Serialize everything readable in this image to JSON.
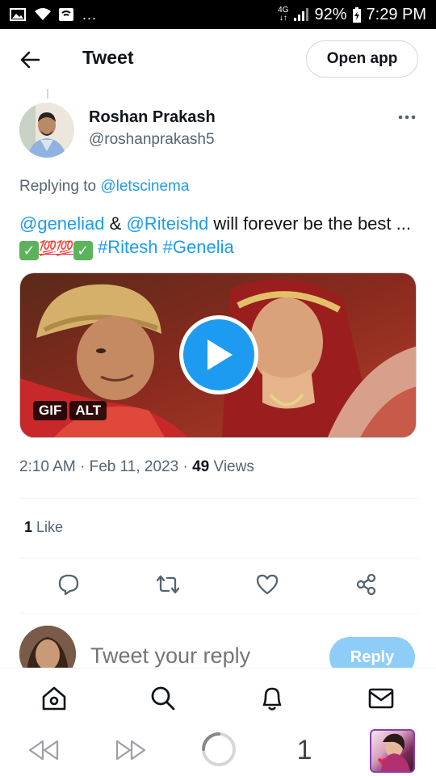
{
  "status_bar": {
    "network": "4G",
    "battery": "92%",
    "time": "7:29 PM",
    "dots": "..."
  },
  "header": {
    "title": "Tweet",
    "open_app_label": "Open app"
  },
  "tweet": {
    "author_name": "Roshan Prakash",
    "author_handle": "@roshanprakash5",
    "replying_prefix": "Replying to",
    "replying_to": "@letscinema",
    "text": {
      "mention1": "@geneliad",
      "amp": "&",
      "mention2": "@Riteishd",
      "middle": "will forever be the best ...",
      "emoji_100": "💯💯",
      "hashtag1": "#Ritesh",
      "hashtag2": "#Genelia"
    },
    "media": {
      "badge_gif": "GIF",
      "badge_alt": "ALT"
    },
    "time": "2:10 AM",
    "date": "Feb 11, 2023",
    "views_count": "49",
    "views_label": "Views",
    "likes_count": "1",
    "likes_label": "Like"
  },
  "composer": {
    "placeholder": "Tweet your reply",
    "reply_label": "Reply"
  },
  "browser": {
    "tab_count": "1"
  },
  "colors": {
    "accent": "#1d9bf0",
    "reply_button": "#8ecdf8",
    "muted_text": "#536471"
  }
}
